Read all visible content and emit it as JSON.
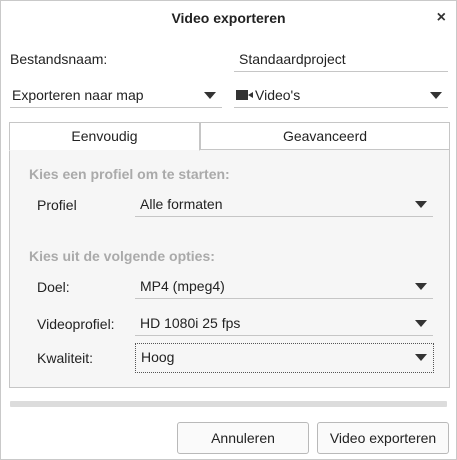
{
  "window": {
    "title": "Video exporteren",
    "close_glyph": "×"
  },
  "filename": {
    "label": "Bestandsnaam:",
    "value": "Standaardproject"
  },
  "export_target": {
    "value": "Exporteren naar map"
  },
  "file_type": {
    "value": "Video's",
    "icon": "video-camera-icon"
  },
  "tabs": [
    {
      "label": "Eenvoudig",
      "selected": true
    },
    {
      "label": "Geavanceerd",
      "selected": false
    }
  ],
  "simple": {
    "profile_heading": "Kies een profiel om te starten:",
    "profile_label": "Profiel",
    "profile_value": "Alle formaten",
    "options_heading": "Kies uit de volgende opties:",
    "target_label": "Doel:",
    "target_value": "MP4 (mpeg4)",
    "videoprofile_label": "Videoprofiel:",
    "videoprofile_value": "HD 1080i 25 fps",
    "quality_label": "Kwaliteit:",
    "quality_value": "Hoog"
  },
  "progress": {
    "fraction": 0
  },
  "buttons": {
    "cancel": "Annuleren",
    "export": "Video exporteren"
  },
  "colors": {
    "section_heading": "#aaaaaa",
    "progress_fill": "#7aa7d8"
  }
}
